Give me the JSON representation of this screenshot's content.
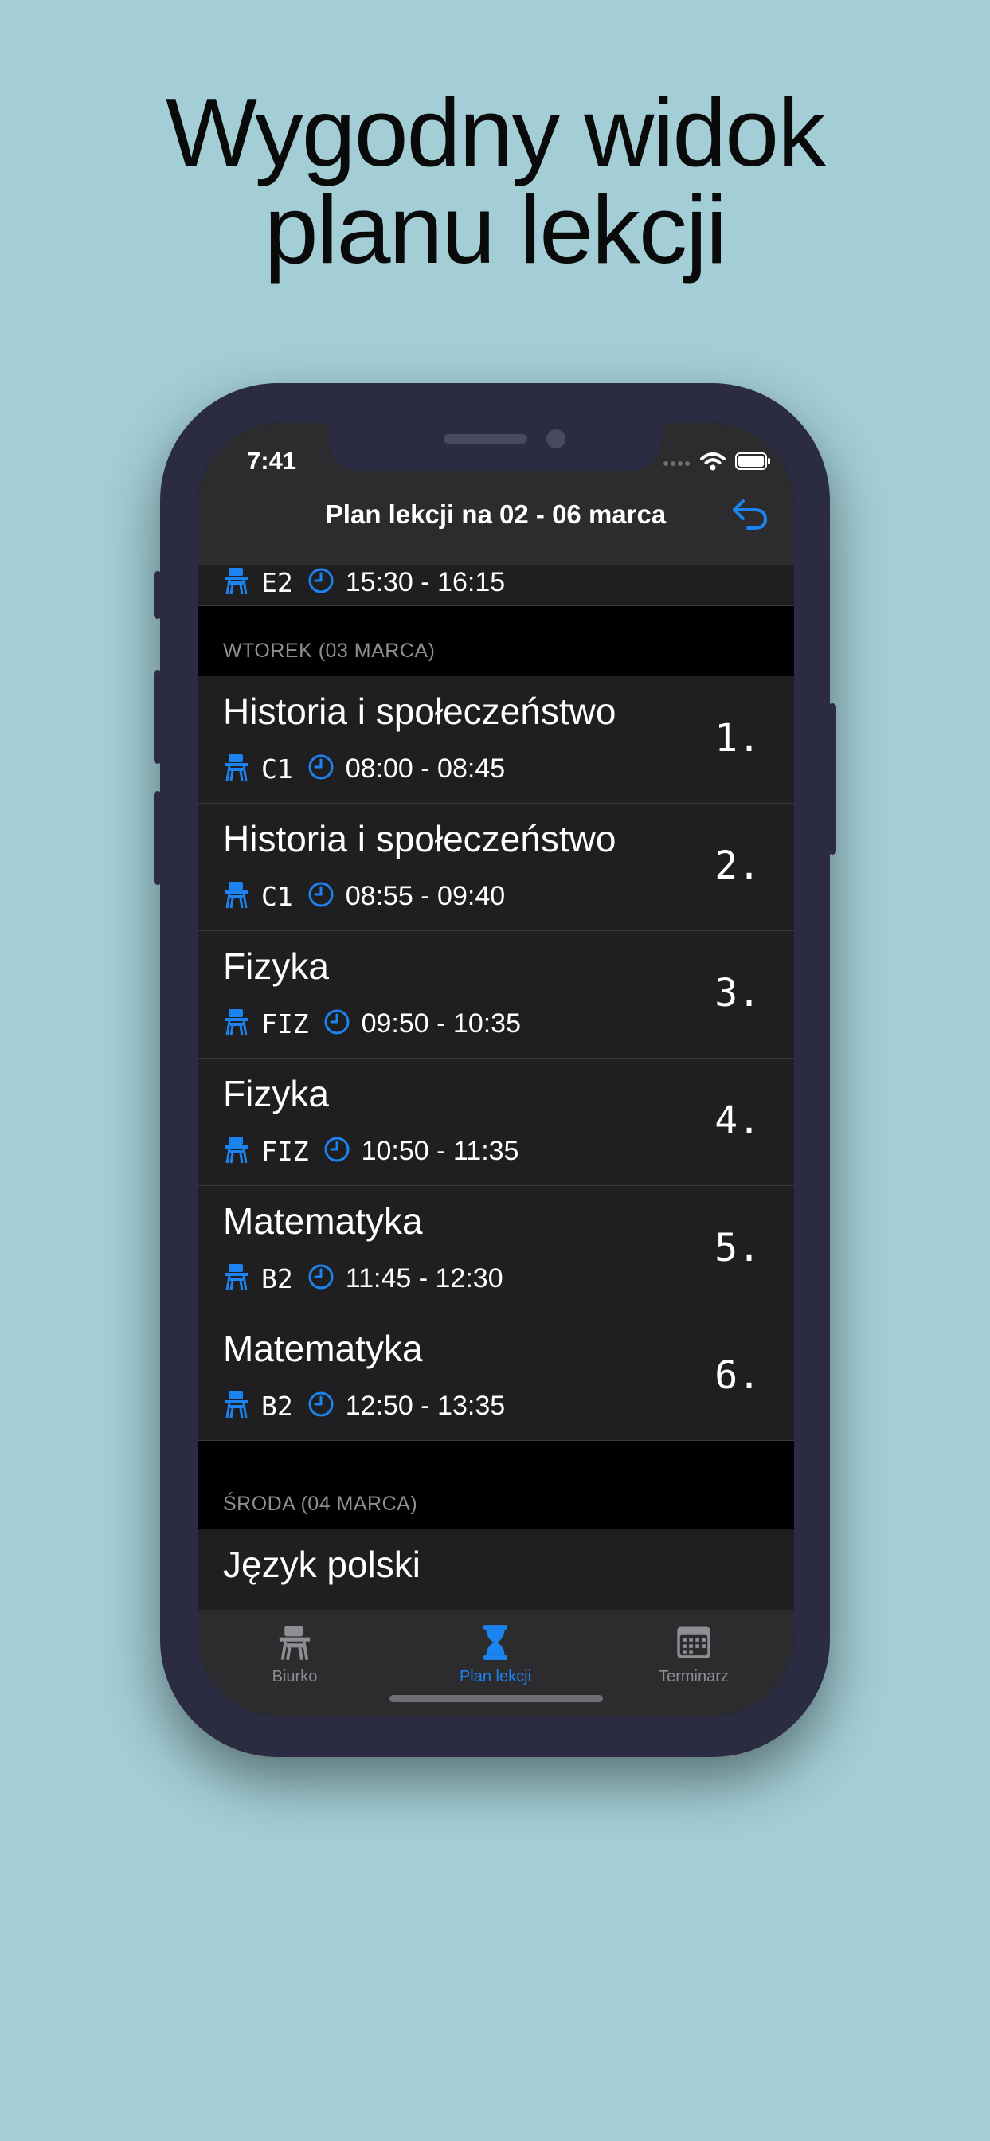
{
  "headline": {
    "line1": "Wygodny widok",
    "line2": "planu lekcji"
  },
  "status_bar": {
    "time": "7:41"
  },
  "nav": {
    "title": "Plan lekcji na 02 - 06 marca"
  },
  "previous_entry": {
    "room": "E2",
    "hours": "15:30 - 16:15"
  },
  "sections": [
    {
      "header": "WTOREK (03 MARCA)",
      "lessons": [
        {
          "subject": "Historia i społeczeństwo",
          "room": "C1",
          "hours": "08:00 - 08:45",
          "number": "1."
        },
        {
          "subject": "Historia i społeczeństwo",
          "room": "C1",
          "hours": "08:55 - 09:40",
          "number": "2."
        },
        {
          "subject": "Fizyka",
          "room": "FIZ",
          "hours": "09:50 - 10:35",
          "number": "3."
        },
        {
          "subject": "Fizyka",
          "room": "FIZ",
          "hours": "10:50 - 11:35",
          "number": "4."
        },
        {
          "subject": "Matematyka",
          "room": "B2",
          "hours": "11:45 - 12:30",
          "number": "5."
        },
        {
          "subject": "Matematyka",
          "room": "B2",
          "hours": "12:50 - 13:35",
          "number": "6."
        }
      ]
    },
    {
      "header": "ŚRODA (04 MARCA)",
      "lessons": [
        {
          "subject": "Język polski"
        }
      ]
    }
  ],
  "tabs": [
    {
      "label": "Biurko",
      "icon": "desk-icon",
      "active": false
    },
    {
      "label": "Plan lekcji",
      "icon": "hourglass-icon",
      "active": true
    },
    {
      "label": "Terminarz",
      "icon": "calendar-icon",
      "active": false
    }
  ],
  "colors": {
    "background": "#a3ced5",
    "accent": "#1c84f1",
    "phone_frame": "#2b2b42",
    "row": "#1f1f21"
  }
}
